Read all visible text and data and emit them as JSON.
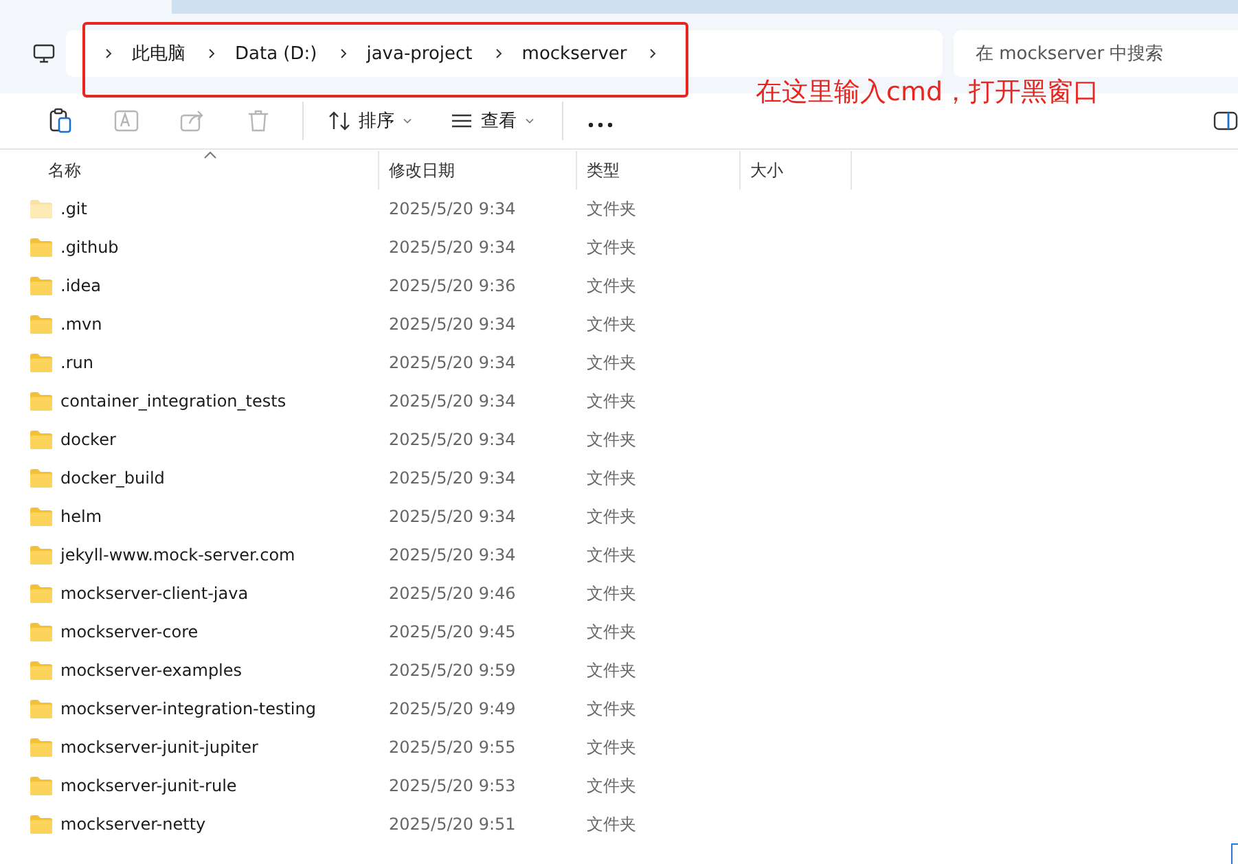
{
  "breadcrumb": [
    "此电脑",
    "Data (D:)",
    "java-project",
    "mockserver"
  ],
  "search": {
    "placeholder": "在 mockserver 中搜索"
  },
  "toolbar": [
    {
      "kind": "paste",
      "disabled": false
    },
    {
      "kind": "rename",
      "disabled": true
    },
    {
      "kind": "share",
      "disabled": true
    },
    {
      "kind": "delete",
      "disabled": true
    },
    {
      "kind": "sort",
      "label": "排序"
    },
    {
      "kind": "view",
      "label": "查看"
    },
    {
      "kind": "more"
    }
  ],
  "columns": [
    "名称",
    "修改日期",
    "类型",
    "大小"
  ],
  "rows": [
    {
      "name": ".git",
      "modified": "2025/5/20 9:34",
      "type": "文件夹",
      "hidden": true
    },
    {
      "name": ".github",
      "modified": "2025/5/20 9:34",
      "type": "文件夹",
      "hidden": false
    },
    {
      "name": ".idea",
      "modified": "2025/5/20 9:36",
      "type": "文件夹",
      "hidden": false
    },
    {
      "name": ".mvn",
      "modified": "2025/5/20 9:34",
      "type": "文件夹",
      "hidden": false
    },
    {
      "name": ".run",
      "modified": "2025/5/20 9:34",
      "type": "文件夹",
      "hidden": false
    },
    {
      "name": "container_integration_tests",
      "modified": "2025/5/20 9:34",
      "type": "文件夹",
      "hidden": false
    },
    {
      "name": "docker",
      "modified": "2025/5/20 9:34",
      "type": "文件夹",
      "hidden": false
    },
    {
      "name": "docker_build",
      "modified": "2025/5/20 9:34",
      "type": "文件夹",
      "hidden": false
    },
    {
      "name": "helm",
      "modified": "2025/5/20 9:34",
      "type": "文件夹",
      "hidden": false
    },
    {
      "name": "jekyll-www.mock-server.com",
      "modified": "2025/5/20 9:34",
      "type": "文件夹",
      "hidden": false
    },
    {
      "name": "mockserver-client-java",
      "modified": "2025/5/20 9:46",
      "type": "文件夹",
      "hidden": false
    },
    {
      "name": "mockserver-core",
      "modified": "2025/5/20 9:45",
      "type": "文件夹",
      "hidden": false
    },
    {
      "name": "mockserver-examples",
      "modified": "2025/5/20 9:59",
      "type": "文件夹",
      "hidden": false
    },
    {
      "name": "mockserver-integration-testing",
      "modified": "2025/5/20 9:49",
      "type": "文件夹",
      "hidden": false
    },
    {
      "name": "mockserver-junit-jupiter",
      "modified": "2025/5/20 9:55",
      "type": "文件夹",
      "hidden": false
    },
    {
      "name": "mockserver-junit-rule",
      "modified": "2025/5/20 9:53",
      "type": "文件夹",
      "hidden": false
    },
    {
      "name": "mockserver-netty",
      "modified": "2025/5/20 9:51",
      "type": "文件夹",
      "hidden": false
    }
  ],
  "annotation": {
    "text": "在这里输入cmd，打开黑窗口"
  }
}
